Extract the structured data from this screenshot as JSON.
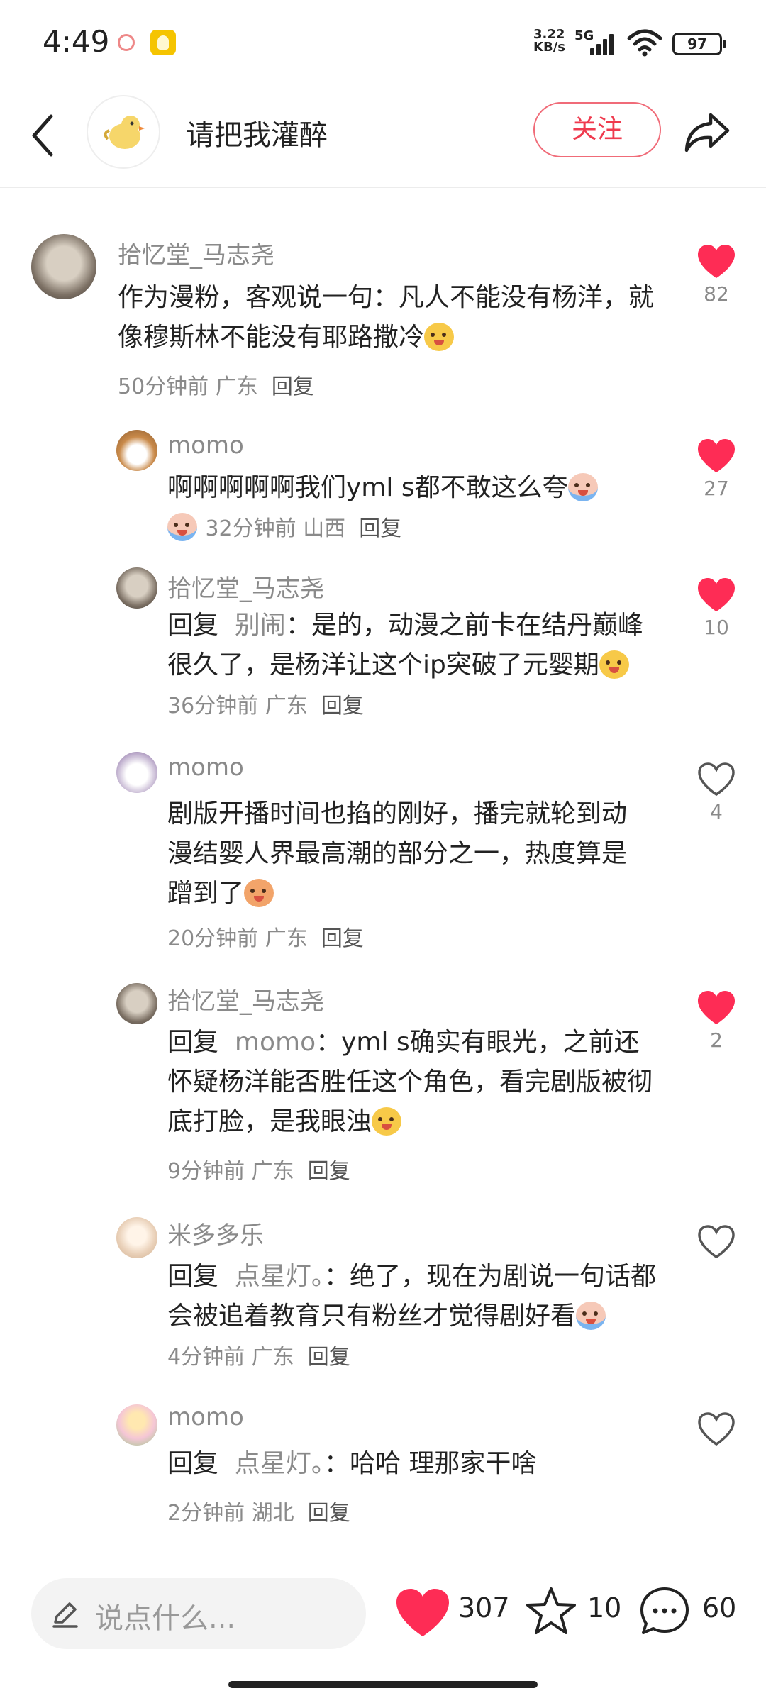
{
  "status_bar": {
    "time": "4:49",
    "net_speed": "3.22",
    "net_unit": "KB/s",
    "network": "5G",
    "battery": "97"
  },
  "header": {
    "title": "请把我灌醉",
    "follow_label": "关注"
  },
  "comments": [
    {
      "user": "拾忆堂_马志尧",
      "text": "作为漫粉，客观说一句：凡人不能没有杨洋，就像穆斯林不能没有耶路撒冷",
      "time": "50分钟前",
      "location": "广东",
      "reply": "回复",
      "likes": "82",
      "liked": true
    },
    {
      "user": "momo",
      "text": "啊啊啊啊啊我们yml s都不敢这么夸",
      "time": "32分钟前",
      "location": "山西",
      "reply": "回复",
      "likes": "27",
      "liked": true
    },
    {
      "user": "拾忆堂_马志尧",
      "reply_prefix": "回复",
      "reply_to": "别闹",
      "text": "是的，动漫之前卡在结丹巅峰很久了，是杨洋让这个ip突破了元婴期",
      "time": "36分钟前",
      "location": "广东",
      "reply": "回复",
      "likes": "10",
      "liked": true
    },
    {
      "user": "momo",
      "text": "剧版开播时间也掐的刚好，播完就轮到动漫结婴人界最高潮的部分之一，热度算是蹭到了",
      "time": "20分钟前",
      "location": "广东",
      "reply": "回复",
      "likes": "4",
      "liked": false
    },
    {
      "user": "拾忆堂_马志尧",
      "reply_prefix": "回复",
      "reply_to": "momo",
      "text": "yml s确实有眼光，之前还怀疑杨洋能否胜任这个角色，看完剧版被彻底打脸，是我眼浊",
      "time": "9分钟前",
      "location": "广东",
      "reply": "回复",
      "likes": "2",
      "liked": true
    },
    {
      "user": "米多多乐",
      "reply_prefix": "回复",
      "reply_to": "点星灯。",
      "text": "绝了，现在为剧说一句话都会被追着教育只有粉丝才觉得剧好看",
      "time": "4分钟前",
      "location": "广东",
      "reply": "回复",
      "likes": "",
      "liked": false
    },
    {
      "user": "momo",
      "reply_prefix": "回复",
      "reply_to": "点星灯。",
      "text": "哈哈 理那家干啥",
      "time": "2分钟前",
      "location": "湖北",
      "reply": "回复",
      "likes": "",
      "liked": false
    }
  ],
  "bottom_bar": {
    "input_placeholder": "说点什么...",
    "likes": "307",
    "favorites": "10",
    "comments": "60"
  },
  "colors": {
    "accent_red": "#ef3a4e",
    "muted_text": "#8a8a8a"
  }
}
